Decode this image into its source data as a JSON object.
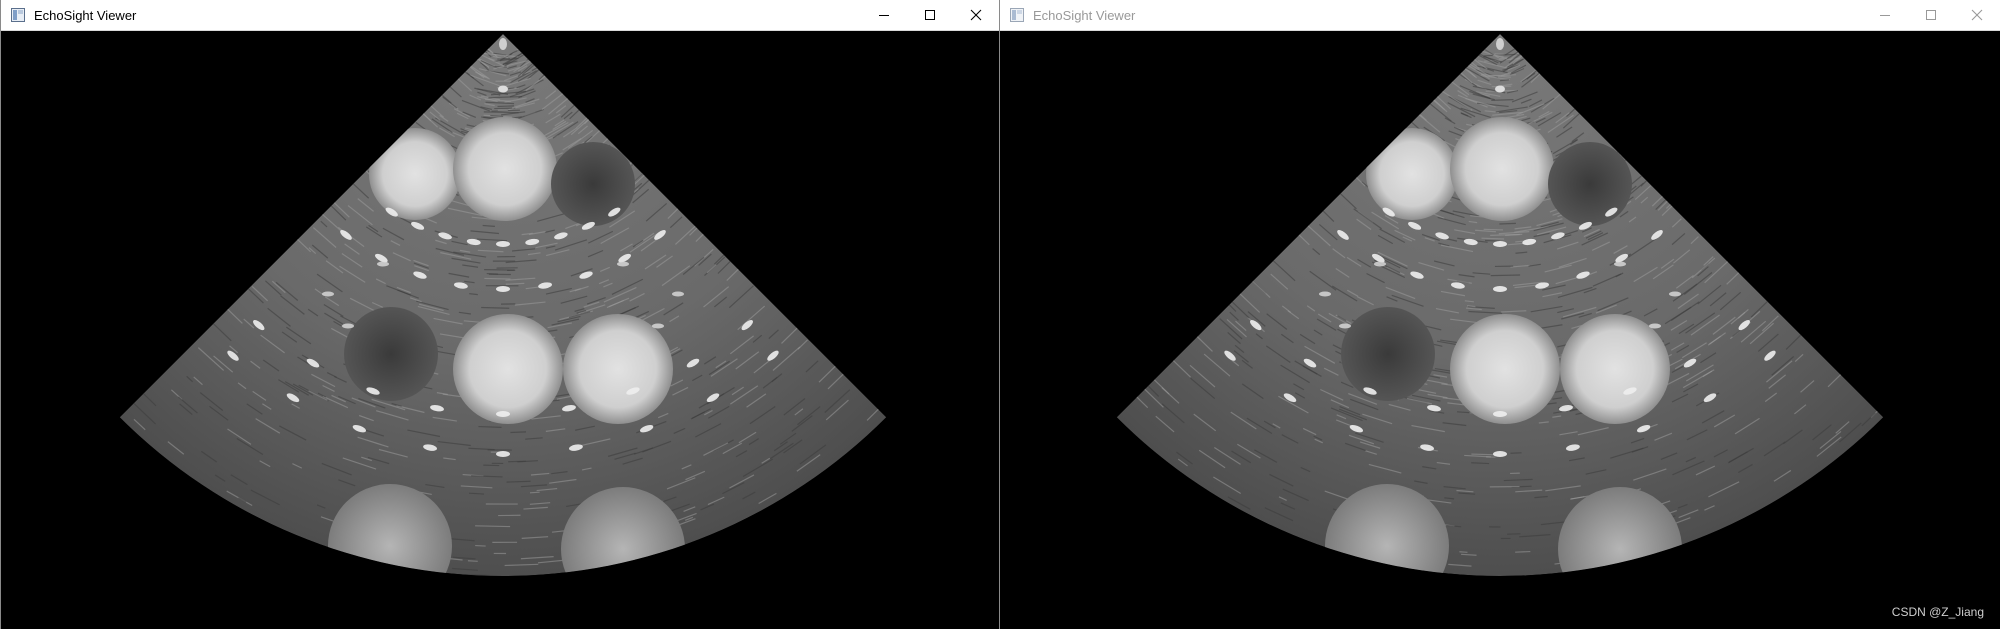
{
  "windows": [
    {
      "title": "EchoSight Viewer",
      "active": true
    },
    {
      "title": "EchoSight Viewer",
      "active": false
    }
  ],
  "watermark": "CSDN @Z_Jiang",
  "colors": {
    "titlebar_bg": "#ffffff",
    "inactive_title": "#999999",
    "image_bg": "#000000"
  },
  "icons": [
    "app-window-icon",
    "minimize-icon",
    "maximize-icon",
    "close-icon"
  ]
}
